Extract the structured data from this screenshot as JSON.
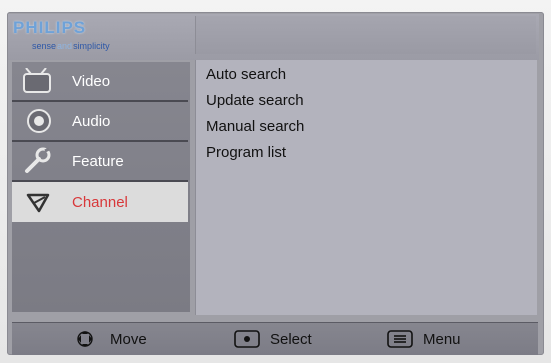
{
  "brand": {
    "name": "PHILIPS",
    "tagline_left": "sense",
    "tagline_mid": "and",
    "tagline_right": "simplicity"
  },
  "menu": {
    "items": [
      {
        "label": "Video",
        "icon": "tv-icon"
      },
      {
        "label": "Audio",
        "icon": "speaker-icon"
      },
      {
        "label": "Feature",
        "icon": "wrench-icon"
      },
      {
        "label": "Channel",
        "icon": "antenna-icon",
        "selected": true
      }
    ]
  },
  "submenu": {
    "items": [
      "Auto search",
      "Update search",
      "Manual search",
      "Program list"
    ]
  },
  "footer": {
    "move_label": "Move",
    "select_label": "Select",
    "menu_label": "Menu"
  },
  "colors": {
    "selected_text": "#d8383a",
    "brand_blue": "#6fa2d8"
  }
}
